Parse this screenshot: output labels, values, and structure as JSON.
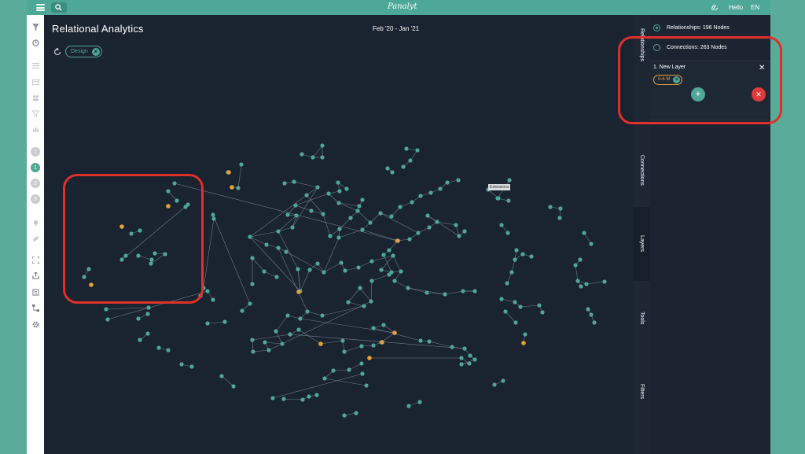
{
  "topbar": {
    "brand": "Panalyt",
    "hello": "Hello",
    "language": "EN"
  },
  "leftnav": {
    "icons": [
      "filter-icon",
      "clock-icon",
      "list-icon",
      "table-icon",
      "tag-icon",
      "funnel-icon",
      "chart-icon"
    ],
    "steps": [
      "1",
      "1",
      "2",
      "3"
    ],
    "tools": [
      "bulb-icon",
      "rocket-icon",
      "expand-icon",
      "export-icon",
      "report-icon",
      "flow-icon",
      "settings-icon"
    ]
  },
  "header": {
    "title": "Relational Analytics",
    "date_range": "Feb '20 - Jan '21",
    "filter_chip": "Design"
  },
  "graph": {
    "tooltip": "Extensions",
    "node_color": "#4ea898",
    "highlight_color": "#e6a13a",
    "edge_color": "#8f9aa6"
  },
  "side_tabs": [
    "Relationships",
    "Connections",
    "Layers",
    "Tools",
    "Filters"
  ],
  "active_tab": "Layers",
  "panel": {
    "option_relationships": "Relationships: 196 Nodes",
    "option_connections": "Connections: 263 Nodes",
    "layer_title": "1. New Layer",
    "range_chip": "0-6 M"
  }
}
